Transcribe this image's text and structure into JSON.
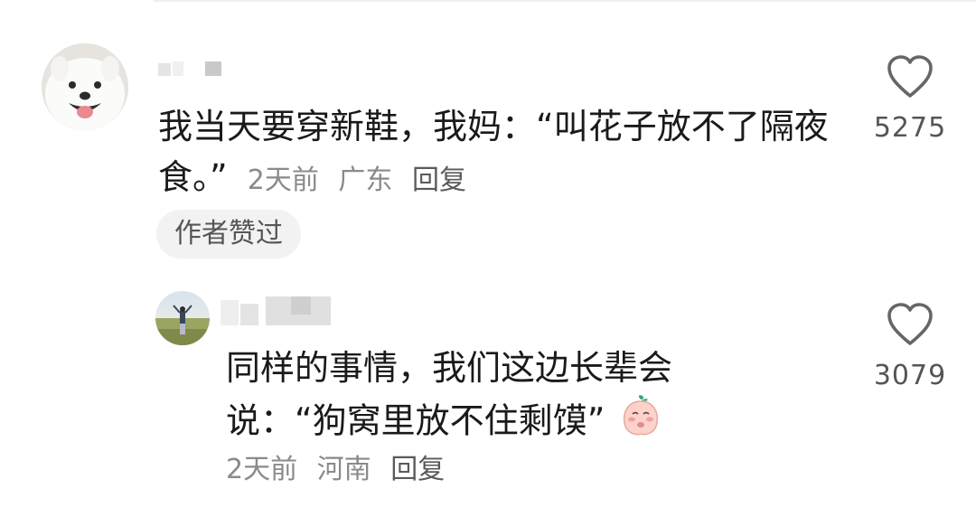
{
  "comment": {
    "text": "我当天要穿新鞋，我妈：“叫花子放不了隔夜食。”",
    "time": "2天前",
    "location": "广东",
    "reply_label": "回复",
    "author_liked": "作者赞过",
    "likes": "5275",
    "avatar_icon": "samoyed-dog-avatar",
    "like_icon": "heart-outline-icon"
  },
  "reply": {
    "text_line1": "同样的事情，我们这边长辈会",
    "text_line2": "说：“狗窝里放不住剩馍”",
    "emoji_icon": "blushing-peach-emoji",
    "time": "2天前",
    "location": "河南",
    "reply_label": "回复",
    "likes": "3079",
    "avatar_icon": "person-on-grassland-avatar",
    "like_icon": "heart-outline-icon"
  },
  "colors": {
    "text_primary": "#1a1a1a",
    "text_meta": "#8a8a8a",
    "badge_bg": "#f2f2f2"
  }
}
